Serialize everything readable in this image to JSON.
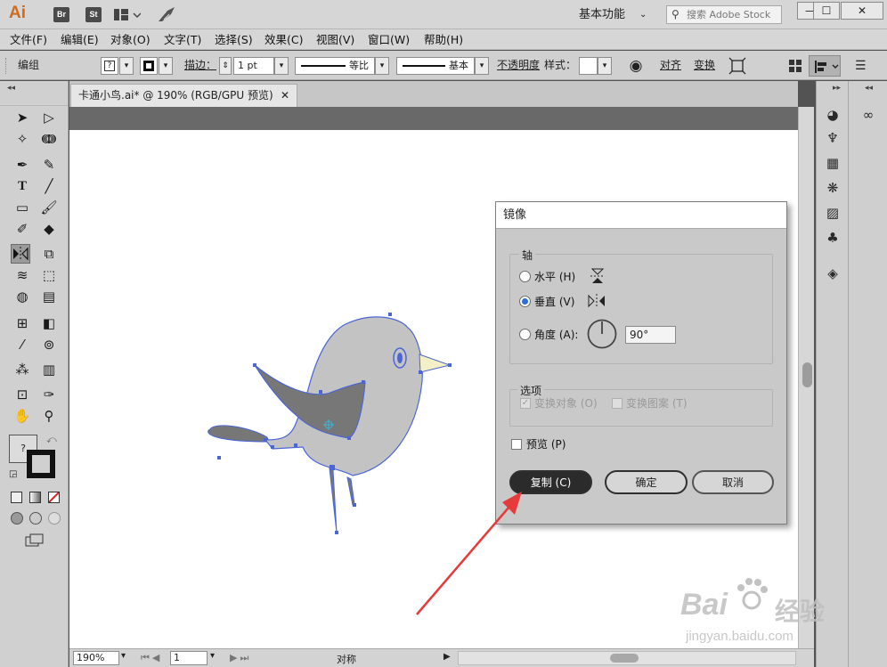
{
  "app": {
    "logo": "Ai",
    "bridge_btn": "Br",
    "stock_btn": "St",
    "workspace": "基本功能",
    "search_placeholder": "搜索 Adobe Stock"
  },
  "menu": [
    "文件(F)",
    "编辑(E)",
    "对象(O)",
    "文字(T)",
    "选择(S)",
    "效果(C)",
    "视图(V)",
    "窗口(W)",
    "帮助(H)"
  ],
  "control": {
    "group_label": "编组",
    "stroke_label": "描边：",
    "stroke_value": "1 pt",
    "profile_label": "等比",
    "brush_label": "基本",
    "opacity_label": "不透明度",
    "style_label": "样式：",
    "align_label": "对齐",
    "transform_label": "变换"
  },
  "document": {
    "tab_title": "卡通小鸟.ai* @ 190% (RGB/GPU 预览)"
  },
  "status": {
    "zoom": "190%",
    "artboard": "1",
    "mode": "对称"
  },
  "dialog": {
    "title": "镜像",
    "axis_label": "轴",
    "horizontal_label": "水平 (H)",
    "vertical_label": "垂直 (V)",
    "angle_label": "角度 (A):",
    "angle_value": "90°",
    "options_label": "选项",
    "transform_objects_label": "变换对象 (O)",
    "transform_patterns_label": "变换图案 (T)",
    "preview_label": "预览 (P)",
    "copy_button": "复制 (C)",
    "ok_button": "确定",
    "cancel_button": "取消",
    "selected_axis": "vertical"
  },
  "watermark": {
    "brand": "Bai",
    "brand_cn": "经验",
    "url": "jingyan.baidu.com"
  },
  "colors": {
    "accent": "#2b6fd6",
    "selection": "#4b66d4",
    "arrow": "#e53b3b",
    "bird_body": "#c3c3c3",
    "bird_dark": "#777777"
  }
}
